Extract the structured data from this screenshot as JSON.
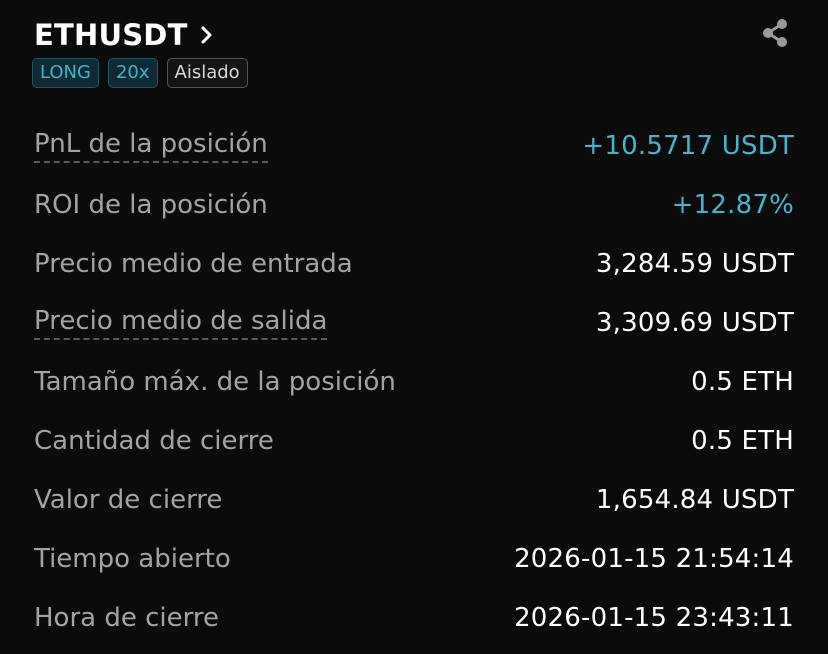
{
  "header": {
    "symbol": "ETHUSDT",
    "chevron_icon": "chevron-right-icon",
    "share_icon": "share-icon"
  },
  "tags": {
    "side": "LONG",
    "leverage": "20x",
    "margin_mode": "Aislado"
  },
  "colors": {
    "background": "#0b0b0b",
    "positive": "#45b4cf",
    "label": "#a3a3a3",
    "value": "#ffffff"
  },
  "details": [
    {
      "label": "PnL de la posición",
      "value": "+10.5717 USDT"
    },
    {
      "label": "ROI de la posición",
      "value": "+12.87%"
    },
    {
      "label": "Precio medio de entrada",
      "value": "3,284.59 USDT"
    },
    {
      "label": "Precio medio de salida",
      "value": "3,309.69 USDT"
    },
    {
      "label": "Tamaño máx. de la posición",
      "value": "0.5 ETH"
    },
    {
      "label": "Cantidad de cierre",
      "value": "0.5 ETH"
    },
    {
      "label": "Valor de cierre",
      "value": "1,654.84 USDT"
    },
    {
      "label": "Tiempo abierto",
      "value": "2026-01-15 21:54:14"
    },
    {
      "label": "Hora de cierre",
      "value": "2026-01-15 23:43:11"
    }
  ]
}
